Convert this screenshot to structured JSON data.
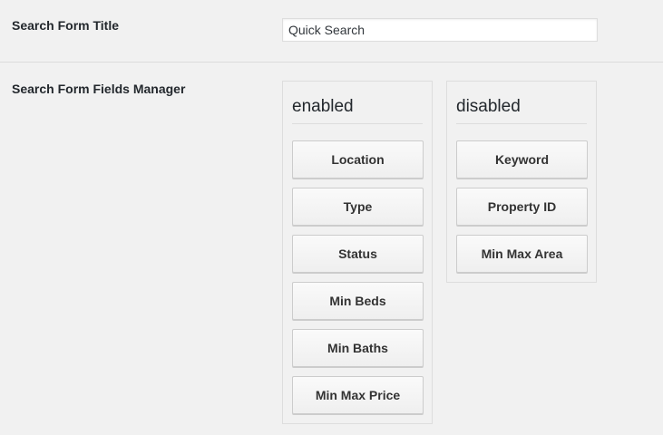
{
  "form_title": {
    "label": "Search Form Title",
    "value": "Quick Search"
  },
  "fields_manager": {
    "label": "Search Form Fields Manager",
    "enabled": {
      "title": "enabled",
      "items": [
        "Location",
        "Type",
        "Status",
        "Min Beds",
        "Min Baths",
        "Min Max Price"
      ]
    },
    "disabled": {
      "title": "disabled",
      "items": [
        "Keyword",
        "Property ID",
        "Min Max Area"
      ]
    }
  }
}
